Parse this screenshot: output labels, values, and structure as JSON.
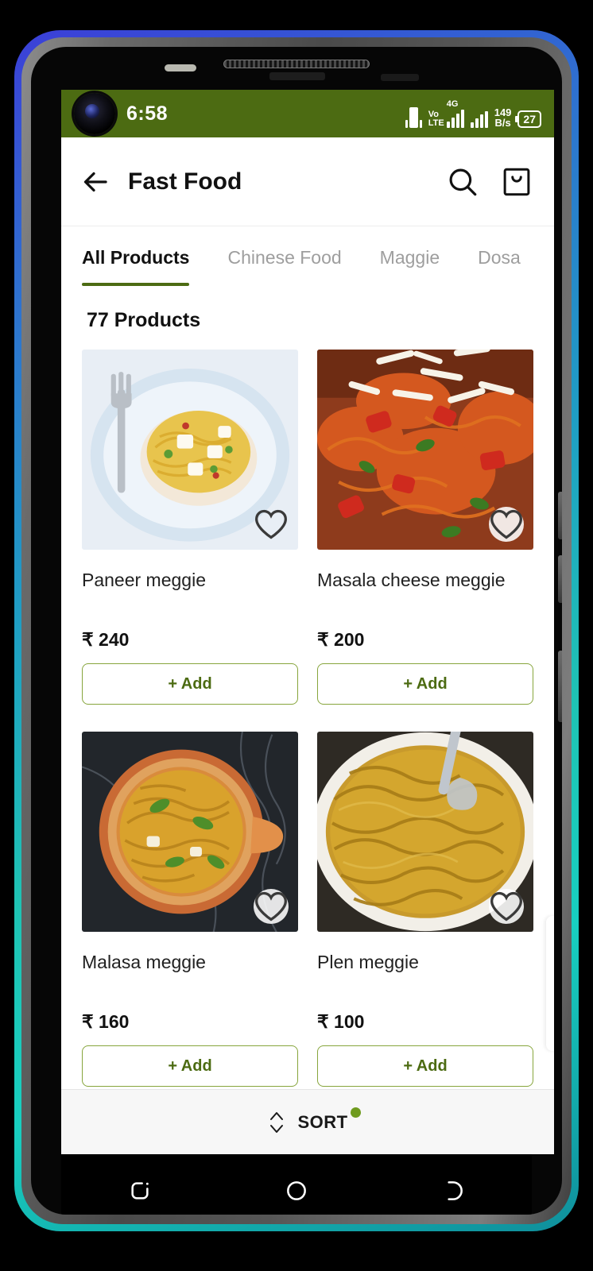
{
  "status_bar": {
    "time": "6:58",
    "network_type": "Vo",
    "network_type2": "LTE",
    "generation": "4G",
    "net_speed_value": "149",
    "net_speed_unit": "B/s",
    "battery_level": "27"
  },
  "app_bar": {
    "title": "Fast Food",
    "back_icon": "arrow-left-icon",
    "search_icon": "search-icon",
    "bag_icon": "shopping-bag-icon"
  },
  "tabs": [
    {
      "label": "All Products",
      "active": true
    },
    {
      "label": "Chinese Food",
      "active": false
    },
    {
      "label": "Maggie",
      "active": false
    },
    {
      "label": "Dosa",
      "active": false
    }
  ],
  "content": {
    "product_count_label": "77 Products",
    "add_button_label": "+ Add",
    "favorite_icon": "heart-icon"
  },
  "products": [
    {
      "name": "Paneer meggie",
      "price": "₹ 240",
      "favorited": false,
      "fav_circled": false,
      "image": "paneer-noodles-on-blue-plate-with-fork"
    },
    {
      "name": "Masala cheese meggie",
      "price": "₹ 200",
      "favorited": false,
      "fav_circled": true,
      "image": "masala-cheese-noodles-with-grated-cheese"
    },
    {
      "name": "Malasa meggie",
      "price": "₹ 160",
      "favorited": false,
      "fav_circled": true,
      "image": "noodles-in-clay-bowl-on-dark-marble"
    },
    {
      "name": "Plen meggie",
      "price": "₹ 100",
      "favorited": false,
      "fav_circled": true,
      "image": "plain-noodles-on-white-plate-with-fork"
    }
  ],
  "sort_bar": {
    "label": "SORT",
    "icon": "sort-updown-icon",
    "has_badge": true
  },
  "nav_bar": {
    "recents_icon": "recents-icon",
    "home_icon": "home-circle-icon",
    "back_icon": "back-icon"
  },
  "colors": {
    "accent_green": "#4c6b12",
    "status_bar_green": "#4c6b12",
    "add_border": "#87a53c",
    "sort_dot": "#6f9b1e"
  }
}
